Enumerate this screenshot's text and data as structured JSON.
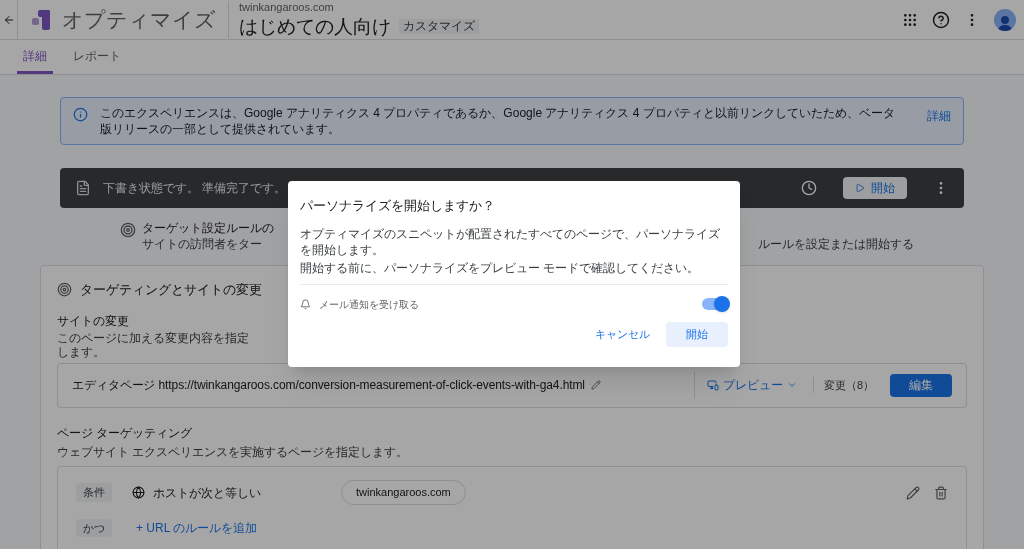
{
  "header": {
    "app_name": "オプティマイズ",
    "domain": "twinkangaroos.com",
    "experience_name": "はじめての人向け",
    "type_badge": "カスタマイズ"
  },
  "tabs": [
    {
      "label": "詳細",
      "selected": true
    },
    {
      "label": "レポート",
      "selected": false
    }
  ],
  "info_banner": {
    "text": "このエクスペリエンスは、Google アナリティクス 4 プロパティであるか、Google アナリティクス 4 プロパティと以前リンクしていたため、ベータ版リリースの一部として提供されています。",
    "link": "詳細"
  },
  "status_bar": {
    "text": "下書き状態です。 準備完了です。",
    "start_button": "開始"
  },
  "steps": {
    "left_title": "ターゲット設定ルールの",
    "left_desc": "サイトの訪問者をター",
    "right_desc": "ルールを設定または開始する"
  },
  "card": {
    "title": "ターゲティングとサイトの変更",
    "site_changes": {
      "heading": "サイトの変更",
      "description": "このページに加える変更内容を指定します。",
      "editor_page": "エディタページ https://twinkangaroos.com/conversion-measurement-of-click-events-with-ga4.html",
      "preview": "プレビュー",
      "changes": "変更（8）",
      "edit": "編集"
    },
    "page_targeting": {
      "heading": "ページ ターゲッティング",
      "description": "ウェブサイト エクスペリエンスを実施するページを指定します。",
      "rules": [
        {
          "chip": "条件",
          "label": "ホストが次と等しい",
          "value": "twinkangaroos.com"
        }
      ],
      "and_chip": "かつ",
      "add_rule": "+ URL のルールを追加"
    }
  },
  "dialog": {
    "title": "パーソナライズを開始しますか？",
    "body": [
      "オプティマイズのスニペットが配置されたすべてのページで、パーソナライズを開始します。",
      "開始する前に、パーソナライズをプレビュー モードで確認してください。"
    ],
    "notification_label": "メール通知を受け取る",
    "notification_on": true,
    "cancel": "キャンセル",
    "confirm": "開始"
  }
}
